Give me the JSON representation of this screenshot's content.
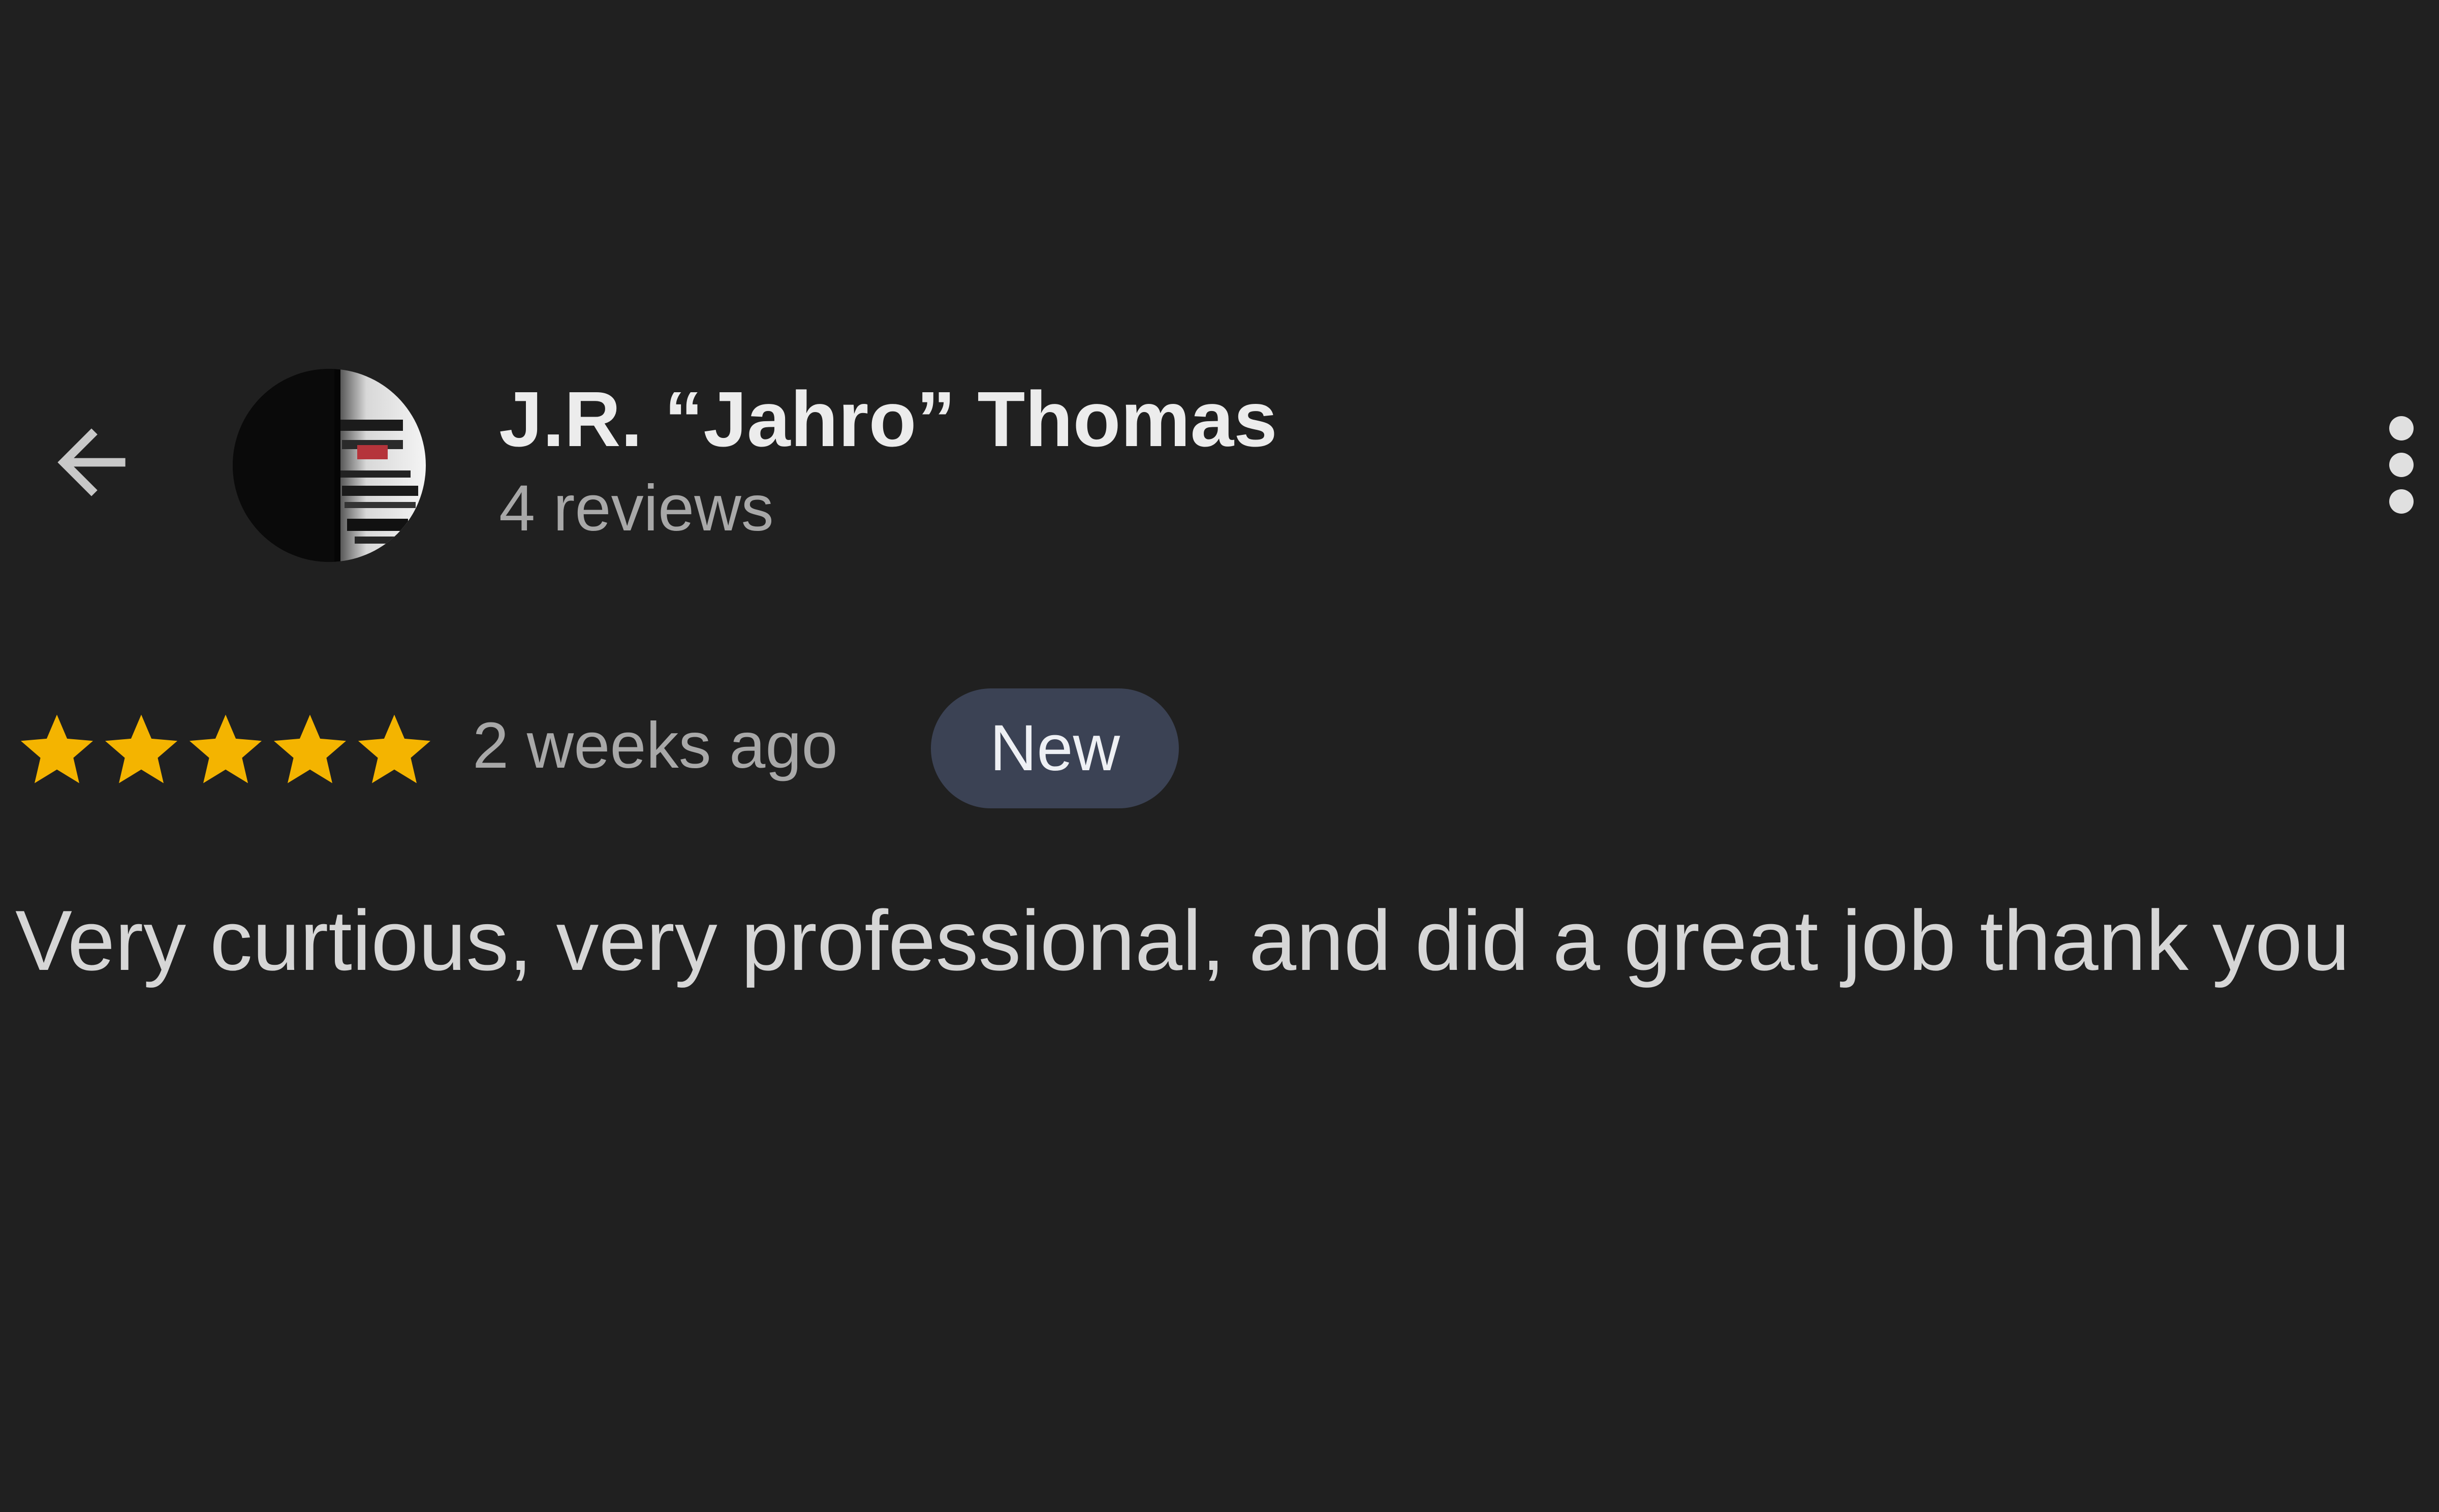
{
  "header": {
    "back_icon": "arrow-left-icon",
    "author_name": "J.R. “Jahro” Thomas",
    "review_count": "4 reviews",
    "more_icon": "more-vert-icon"
  },
  "review": {
    "rating": 5,
    "rating_max": 5,
    "star_icon": "star-icon",
    "time_ago": "2 weeks ago",
    "badge": "New",
    "text": "Very curtious, very professional, and did a great job thank you"
  },
  "colors": {
    "background": "#202020",
    "star": "#f4b400",
    "badge_bg": "#3b4254",
    "name": "#ececec",
    "secondary": "#a8a8a8",
    "body_text": "#d6d6d6"
  }
}
